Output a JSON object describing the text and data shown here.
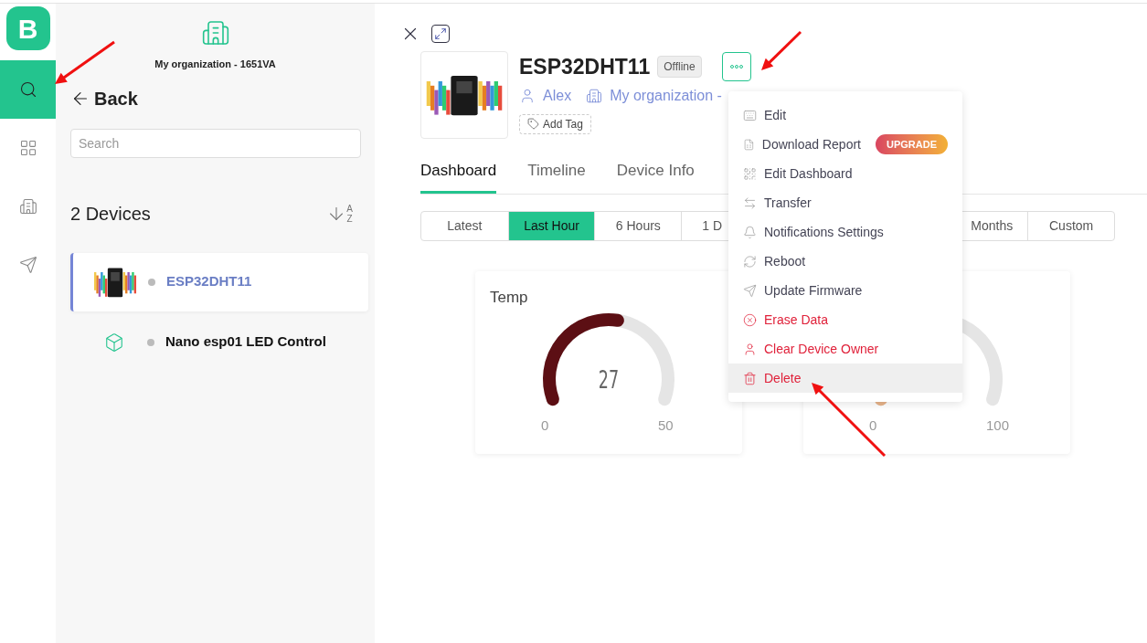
{
  "logo": "B",
  "rail": {
    "items": [
      {
        "kind": "search",
        "selected": true
      },
      {
        "kind": "grid",
        "selected": false
      },
      {
        "kind": "building",
        "selected": false
      },
      {
        "kind": "send",
        "selected": false
      }
    ]
  },
  "panel": {
    "organization": "My organization - 1651VA",
    "back": "Back",
    "search": {
      "placeholder": "Search"
    },
    "count": "2 Devices",
    "sort": {
      "top": "A",
      "bottom": "Z"
    },
    "devices": [
      {
        "name": "ESP32DHT11",
        "kind": "picture",
        "selected": true
      },
      {
        "name": "Nano esp01 LED Control",
        "kind": "cube",
        "selected": false
      }
    ]
  },
  "device": {
    "title": "ESP32DHT11",
    "status": "Offline",
    "owner": "Alex",
    "organization": "My organization -",
    "add_tag": "Add Tag",
    "menu_open": true
  },
  "tabs": [
    {
      "label": "Dashboard",
      "selected": true
    },
    {
      "label": "Timeline",
      "selected": false
    },
    {
      "label": "Device Info",
      "selected": false
    }
  ],
  "ranges": [
    {
      "label": "Latest",
      "selected": false,
      "kind": "shown"
    },
    {
      "label": "Last Hour",
      "selected": true,
      "kind": "shown"
    },
    {
      "label": "6 Hours",
      "selected": false,
      "kind": "shown"
    },
    {
      "label": "1 D",
      "selected": false,
      "kind": "cut"
    },
    {
      "kind": "hidden"
    },
    {
      "kind": "hidden"
    },
    {
      "label": "Months",
      "selected": false,
      "kind": "cut_left"
    },
    {
      "label": "Custom",
      "selected": false,
      "kind": "shown"
    }
  ],
  "gauges": [
    {
      "title": "Temp",
      "value": "27",
      "min": "0",
      "max": "50",
      "level": 0.54,
      "color": "#5c0f14"
    },
    {
      "min": "0",
      "max": "100",
      "level": 0.03,
      "color": "#e8b48a"
    }
  ],
  "menu": [
    {
      "label": "Edit",
      "kind": "keyboard",
      "danger": false,
      "hovered": false
    },
    {
      "label": "Download Report",
      "kind": "sheet",
      "danger": false,
      "hovered": false,
      "badge": "UPGRADE"
    },
    {
      "label": "Edit Dashboard",
      "kind": "dashboard",
      "danger": false,
      "hovered": false
    },
    {
      "label": "Transfer",
      "kind": "transfer",
      "danger": false,
      "hovered": false
    },
    {
      "label": "Notifications Settings",
      "kind": "bell",
      "danger": false,
      "hovered": false
    },
    {
      "label": "Reboot",
      "kind": "reboot",
      "danger": false,
      "hovered": false
    },
    {
      "label": "Update Firmware",
      "kind": "send",
      "danger": false,
      "hovered": false
    },
    {
      "label": "Erase Data",
      "kind": "erase",
      "danger": true,
      "hovered": false
    },
    {
      "label": "Clear Device Owner",
      "kind": "user",
      "danger": true,
      "hovered": false
    },
    {
      "label": "Delete",
      "kind": "trash",
      "danger": true,
      "hovered": true
    }
  ]
}
